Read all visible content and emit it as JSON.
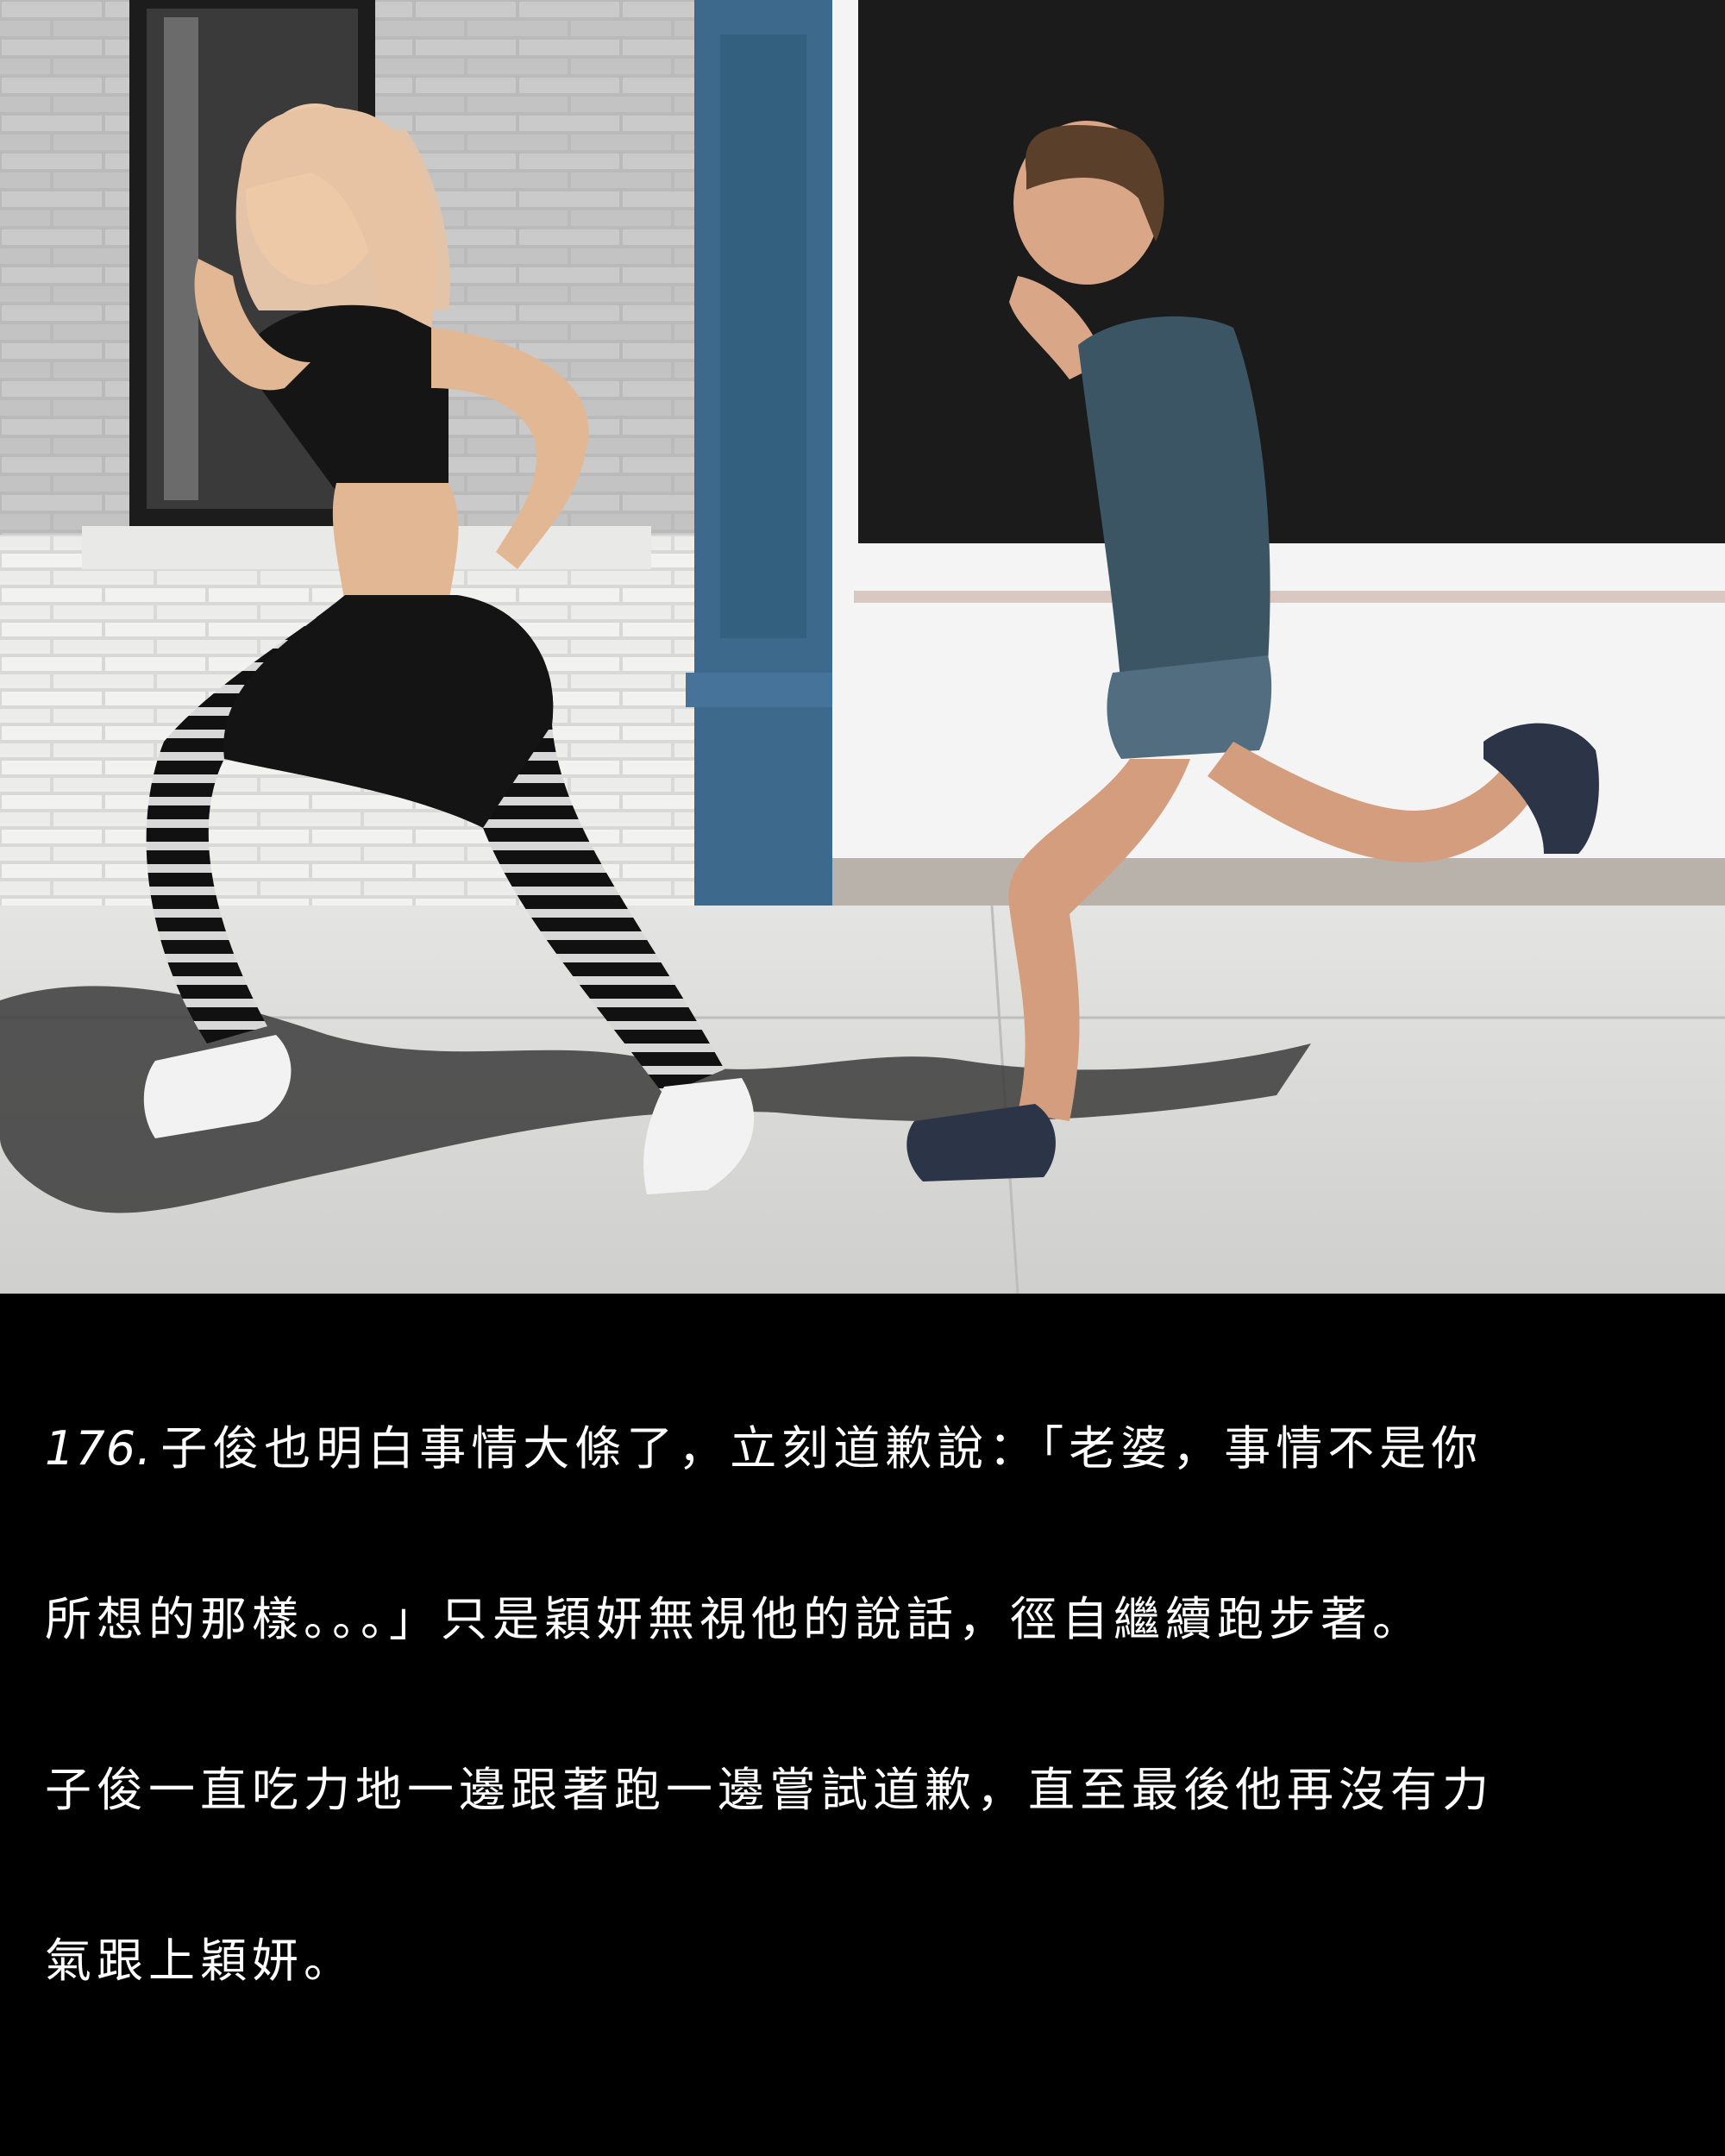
{
  "panel": {
    "number": "176.",
    "lines": [
      "子俊也明白事情大條了，立刻道歉說：「老婆，事情不是你",
      "所想的那樣。。。」只是穎妍無視他的說話，徑自繼續跑步著。",
      "子俊一直吃力地一邊跟著跑一邊嘗試道歉，直至最後他再沒有力",
      "氣跟上穎妍。"
    ]
  },
  "colors": {
    "background": "#000000",
    "text": "#ffffff",
    "pillar": "#3d6a8c",
    "pavement": "#d8d8d6"
  }
}
